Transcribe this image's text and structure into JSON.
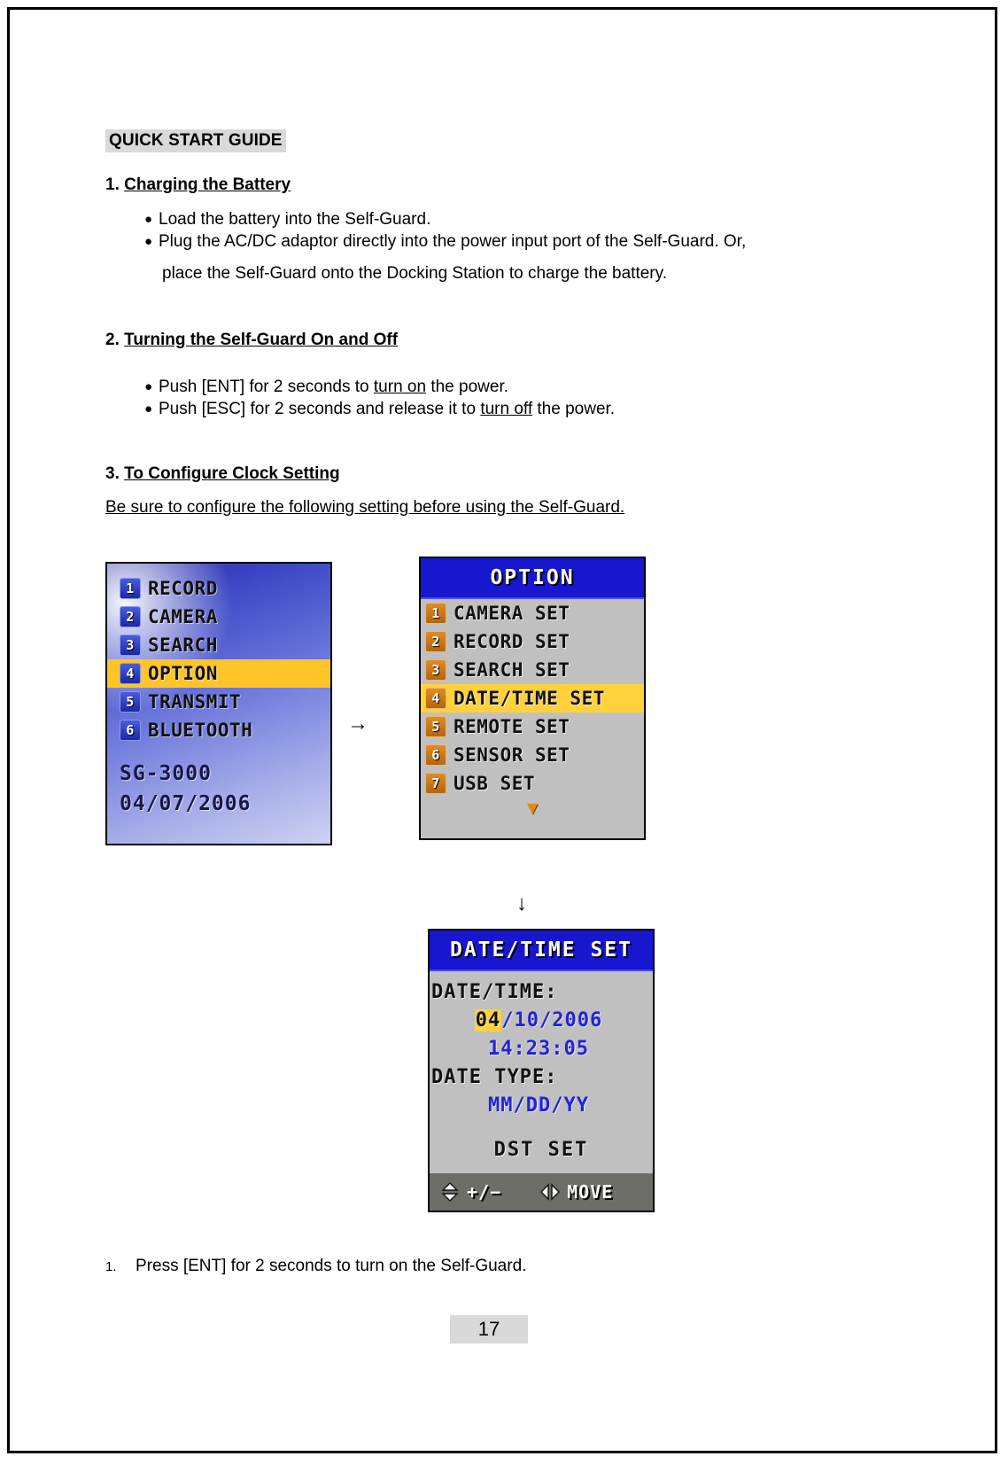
{
  "document": {
    "title": "QUICK START GUIDE",
    "page_number": "17"
  },
  "sections": [
    {
      "number": "1.",
      "title": "Charging the Battery",
      "bullets": [
        "Load the battery into the Self-Guard.",
        "Plug the AC/DC adaptor directly into the power input port of the Self-Guard. Or,",
        "place the Self-Guard onto the Docking Station to charge the battery."
      ]
    },
    {
      "number": "2.",
      "title": "Turning the Self-Guard On and Off",
      "bullets": [
        "Push [ENT] for 2 seconds to turn on the power.",
        "Push [ESC] for 2 seconds and release it to turn off the power."
      ]
    },
    {
      "number": "3.",
      "title": "To Configure Clock Setting ",
      "note": "Be sure to configure the following setting before using the Self-Guard."
    }
  ],
  "bullet_fragments": {
    "b2_1_pre": "Push [ENT] for 2 seconds to ",
    "b2_1_u": "turn on",
    "b2_1_post": " the power.",
    "b2_2_pre": "Push [ESC] for 2 seconds and release it to ",
    "b2_2_u": "turn off",
    "b2_2_post": " the power."
  },
  "arrows": {
    "right": "→",
    "down": "↓"
  },
  "screens": {
    "main_menu": {
      "items": [
        {
          "num": "1",
          "label": "RECORD",
          "selected": false
        },
        {
          "num": "2",
          "label": "CAMERA",
          "selected": false
        },
        {
          "num": "3",
          "label": "SEARCH",
          "selected": false
        },
        {
          "num": "4",
          "label": "OPTION",
          "selected": true
        },
        {
          "num": "5",
          "label": "TRANSMIT",
          "selected": false
        },
        {
          "num": "6",
          "label": "BLUETOOTH",
          "selected": false
        }
      ],
      "model": "SG-3000",
      "date": "04/07/2006",
      "colors": {
        "highlight": "#ffc528",
        "badge": "#2a35b8"
      }
    },
    "option_menu": {
      "title": "OPTION",
      "items": [
        {
          "num": "1",
          "label": "CAMERA SET",
          "selected": false
        },
        {
          "num": "2",
          "label": "RECORD SET",
          "selected": false
        },
        {
          "num": "3",
          "label": "SEARCH SET",
          "selected": false
        },
        {
          "num": "4",
          "label": "DATE/TIME SET",
          "selected": true
        },
        {
          "num": "5",
          "label": "REMOTE SET",
          "selected": false
        },
        {
          "num": "6",
          "label": "SENSOR SET",
          "selected": false
        },
        {
          "num": "7",
          "label": "USB SET",
          "selected": false
        }
      ],
      "scroll_indicator": "▼",
      "colors": {
        "titlebar": "#1717d0",
        "highlight": "#ffd23c",
        "badge": "#c87a14",
        "body": "#c0c0c0"
      }
    },
    "datetime_set": {
      "title": "DATE/TIME SET",
      "datetime_label": "DATE/TIME:",
      "date_highlighted": "04",
      "date_rest": "/10/2006",
      "time_value": "14:23:05",
      "datetype_label": "DATE TYPE:",
      "datetype_value": "MM/DD/YY",
      "dst_label": "DST SET",
      "footer": {
        "updown_label": "+/−",
        "leftright_label": "MOVE"
      },
      "colors": {
        "titlebar": "#1717d0",
        "highlight": "#ffd23c",
        "value": "#2222dd",
        "footer": "#6e6e68"
      }
    }
  },
  "footer_steps": [
    {
      "number": "1.",
      "text": "Press [ENT] for 2 seconds to turn on the Self-Guard."
    }
  ]
}
